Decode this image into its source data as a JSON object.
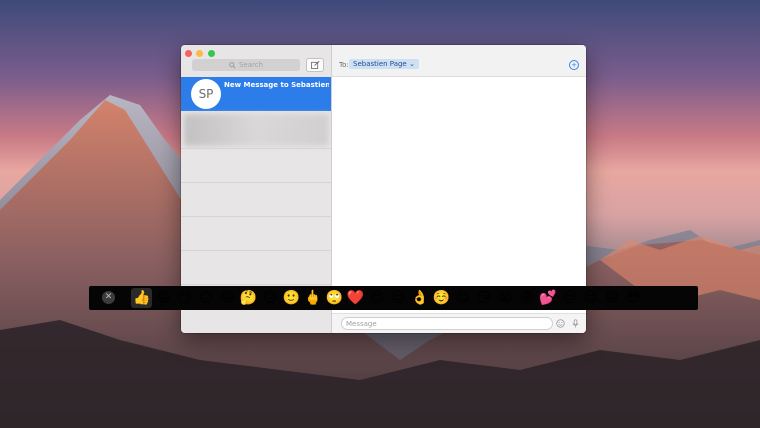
{
  "window": {
    "search_placeholder": "Search",
    "avatar_initials": "SP",
    "conversation_title": "New Message to Sebastien Page",
    "to_label": "To:",
    "recipient": "Sebastien Page",
    "message_placeholder": "Message"
  },
  "touch_bar": {
    "close_glyph": "✕",
    "emojis": [
      "👍",
      "😅",
      "😶",
      "🙃",
      "😂",
      "🤔",
      "😥",
      "🙂",
      "🖕",
      "🙄",
      "❤️",
      "😍",
      "😔",
      "👌",
      "☺️",
      "😊",
      "😘",
      "😭",
      "😩",
      "💕",
      "😒",
      "😌",
      "😁",
      "😳"
    ]
  },
  "colors": {
    "sidebar_selected": "#2c7de9",
    "recipient_chip": "#cfe0f5",
    "touch_bar_bg": "#050505"
  }
}
